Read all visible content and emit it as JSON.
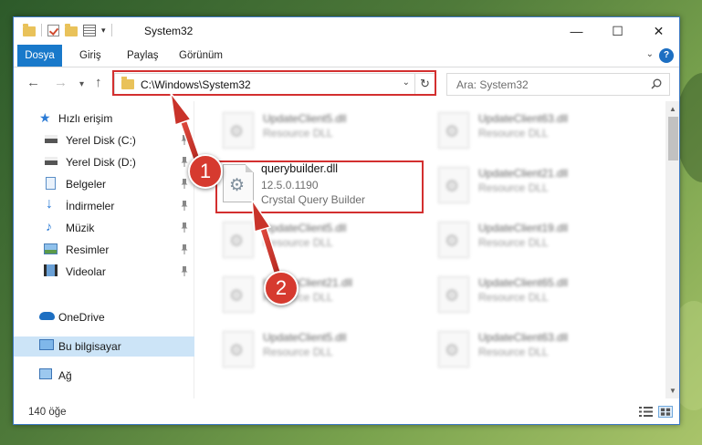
{
  "window": {
    "title": "System32",
    "controls": {
      "minimize": "—",
      "maximize": "☐",
      "close": "✕"
    }
  },
  "ribbon": {
    "tabs": [
      {
        "label": "Dosya"
      },
      {
        "label": "Giriş"
      },
      {
        "label": "Paylaş"
      },
      {
        "label": "Görünüm"
      }
    ],
    "help": "?"
  },
  "navigation": {
    "back_icon": "arrow-left-icon",
    "forward_icon": "arrow-right-icon",
    "recent_icon": "chevron-down-icon",
    "up_icon": "arrow-up-icon",
    "address": "C:\\Windows\\System32",
    "search_placeholder": "Ara: System32"
  },
  "sidebar": {
    "items": [
      {
        "label": "Hızlı erişim",
        "icon": "star-icon"
      },
      {
        "label": "Yerel Disk (C:)",
        "icon": "drive-icon"
      },
      {
        "label": "Yerel Disk (D:)",
        "icon": "drive-icon"
      },
      {
        "label": "Belgeler",
        "icon": "documents-icon"
      },
      {
        "label": "İndirmeler",
        "icon": "download-icon"
      },
      {
        "label": "Müzik",
        "icon": "music-icon"
      },
      {
        "label": "Resimler",
        "icon": "pictures-icon"
      },
      {
        "label": "Videolar",
        "icon": "video-icon"
      },
      {
        "label": "OneDrive",
        "icon": "cloud-icon"
      },
      {
        "label": "Bu bilgisayar",
        "icon": "computer-icon"
      },
      {
        "label": "Ağ",
        "icon": "network-icon"
      }
    ]
  },
  "files": {
    "highlighted": {
      "name": "querybuilder.dll",
      "version": "12.5.0.1190",
      "description": "Crystal Query Builder"
    },
    "background_tiles": [
      {
        "name": "UpdateClient5.dll",
        "desc": "Resource DLL"
      },
      {
        "name": "UpdateClient63.dll",
        "desc": "Resource DLL"
      },
      {
        "name": "UpdateClient21.dll",
        "desc": "Resource DLL"
      },
      {
        "name": "UpdateClient5.dll",
        "desc": "Resource DLL"
      },
      {
        "name": "UpdateClient19.dll",
        "desc": "Resource DLL"
      },
      {
        "name": "UpdateClient21.dll",
        "desc": "Resource DLL"
      },
      {
        "name": "UpdateClient65.dll",
        "desc": "Resource DLL"
      },
      {
        "name": "UpdateClient5.dll",
        "desc": "Resource DLL"
      },
      {
        "name": "UpdateClient63.dll",
        "desc": "Resource DLL"
      }
    ]
  },
  "status": {
    "count": "140 öğe"
  },
  "annotations": {
    "step1": "1",
    "step2": "2",
    "highlight_color": "#d32f2f"
  }
}
